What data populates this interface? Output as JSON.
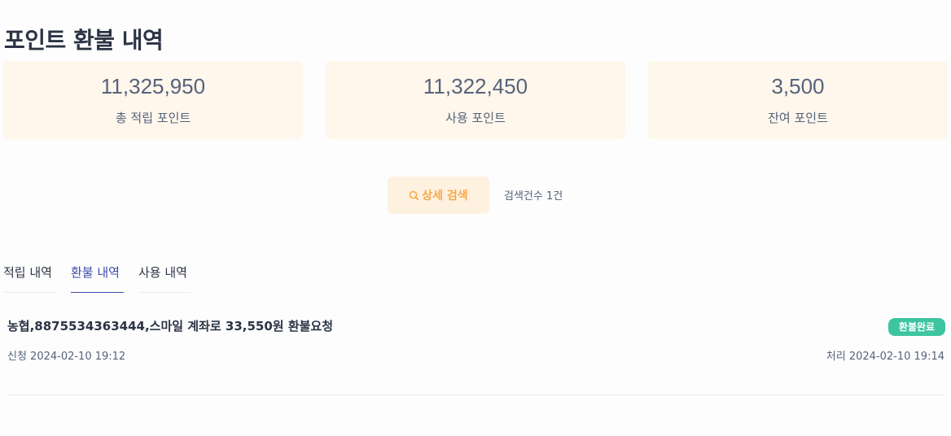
{
  "page": {
    "title": "포인트 환불 내역"
  },
  "summary": {
    "cards": [
      {
        "value": "11,325,950",
        "label": "총 적립 포인트"
      },
      {
        "value": "11,322,450",
        "label": "사용 포인트"
      },
      {
        "value": "3,500",
        "label": "잔여 포인트"
      }
    ]
  },
  "search": {
    "button_label": "상세 검색",
    "result_count": "검색건수 1건"
  },
  "tabs": [
    {
      "label": "적립 내역",
      "active": false
    },
    {
      "label": "환불 내역",
      "active": true
    },
    {
      "label": "사용 내역",
      "active": false
    }
  ],
  "records": [
    {
      "title": "농협,8875534363444,스마일 계좌로 33,550원 환불요청",
      "status": "환불완료",
      "requested": "신청 2024-02-10 19:12",
      "processed": "처리 2024-02-10 19:14"
    }
  ],
  "colors": {
    "accent": "#f6a94a",
    "card_bg": "#fff6ec",
    "active_tab": "#3d4aa8",
    "status_done": "#3dc4a0"
  }
}
